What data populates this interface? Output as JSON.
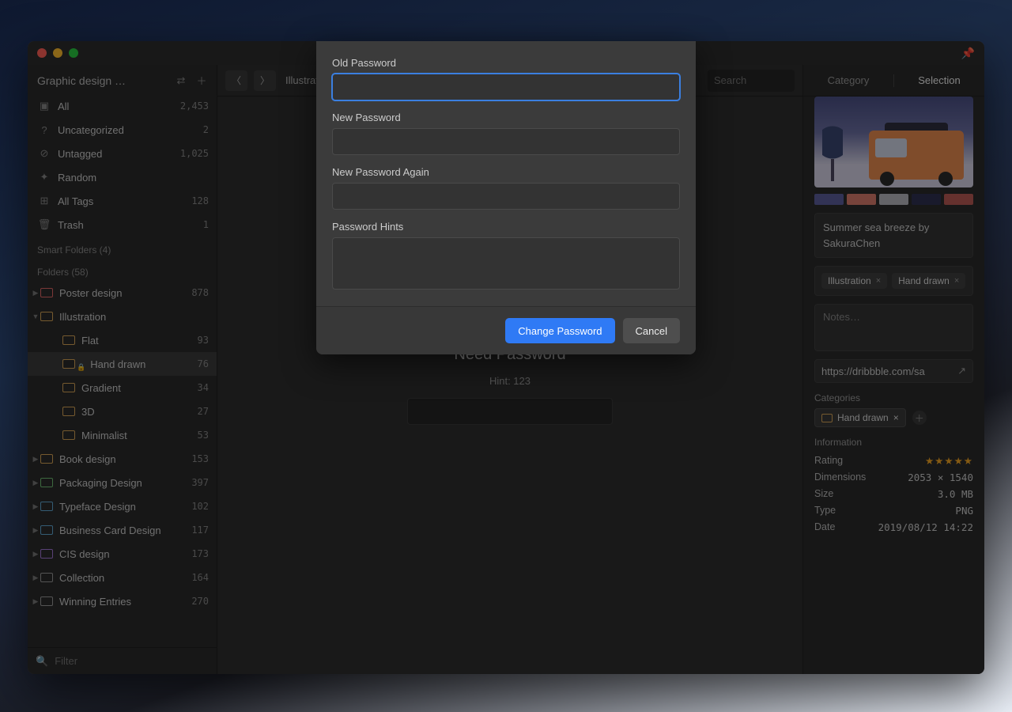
{
  "library_name": "Graphic design …",
  "sidebar_fixed": [
    {
      "icon": "▣",
      "label": "All",
      "count": "2,453"
    },
    {
      "icon": "?",
      "label": "Uncategorized",
      "count": "2"
    },
    {
      "icon": "⊘",
      "label": "Untagged",
      "count": "1,025"
    },
    {
      "icon": "✦",
      "label": "Random",
      "count": ""
    },
    {
      "icon": "⊞",
      "label": "All Tags",
      "count": "128"
    },
    {
      "icon": "🗑",
      "label": "Trash",
      "count": "1"
    }
  ],
  "smart_folders_header": "Smart Folders (4)",
  "folders_header": "Folders (58)",
  "folders": [
    {
      "label": "Poster design",
      "count": "878",
      "color": "#e06666",
      "depth": 0,
      "open": false
    },
    {
      "label": "Illustration",
      "count": "",
      "color": "#d7a556",
      "depth": 0,
      "open": true
    },
    {
      "label": "Flat",
      "count": "93",
      "color": "#d7a556",
      "depth": 1
    },
    {
      "label": "Hand drawn",
      "count": "76",
      "color": "#d7a556",
      "depth": 1,
      "selected": true,
      "locked": true
    },
    {
      "label": "Gradient",
      "count": "34",
      "color": "#d7a556",
      "depth": 1
    },
    {
      "label": "3D",
      "count": "27",
      "color": "#d7a556",
      "depth": 1
    },
    {
      "label": "Minimalist",
      "count": "53",
      "color": "#d7a556",
      "depth": 1
    },
    {
      "label": "Book design",
      "count": "153",
      "color": "#d7a556",
      "depth": 0
    },
    {
      "label": "Packaging Design",
      "count": "397",
      "color": "#6fbf73",
      "depth": 0
    },
    {
      "label": "Typeface Design",
      "count": "102",
      "color": "#5fa8d3",
      "depth": 0
    },
    {
      "label": "Business Card Design",
      "count": "117",
      "color": "#5fa8d3",
      "depth": 0
    },
    {
      "label": "CIS design",
      "count": "173",
      "color": "#a377d8",
      "depth": 0
    },
    {
      "label": "Collection",
      "count": "164",
      "color": "#999999",
      "depth": 0
    },
    {
      "label": "Winning Entries",
      "count": "270",
      "color": "#999999",
      "depth": 0
    }
  ],
  "filter_placeholder": "Filter",
  "breadcrumb": "Illustrat…",
  "search_placeholder": "Search",
  "locked": {
    "title": "Need Password",
    "hint": "Hint: 123"
  },
  "inspector": {
    "tab_category": "Category",
    "tab_selection": "Selection",
    "title": "Summer sea breeze by SakuraChen",
    "tags": [
      "Illustration",
      "Hand drawn"
    ],
    "notes_placeholder": "Notes…",
    "url": "https://dribbble.com/sa",
    "categories_label": "Categories",
    "category_chip": "Hand drawn",
    "info_label": "Information",
    "rows": [
      {
        "k": "Rating",
        "v": "★★★★★",
        "stars": true
      },
      {
        "k": "Dimensions",
        "v": "2053 × 1540"
      },
      {
        "k": "Size",
        "v": "3.0 MB"
      },
      {
        "k": "Type",
        "v": "PNG"
      },
      {
        "k": "Date",
        "v": "2019/08/12 14:22"
      }
    ],
    "swatches": [
      "#5b5e9c",
      "#d97a6c",
      "#b7b7bd",
      "#2f3150",
      "#b85a55"
    ]
  },
  "dialog": {
    "old": "Old Password",
    "new": "New Password",
    "again": "New Password Again",
    "hints": "Password Hints",
    "change": "Change Password",
    "cancel": "Cancel"
  }
}
